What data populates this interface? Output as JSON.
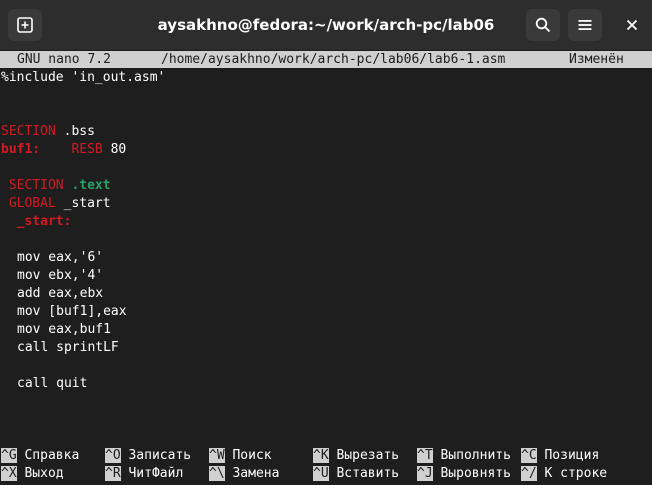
{
  "window": {
    "title": "aysakhno@fedora:~/work/arch-pc/lab06",
    "icons": [
      "new-tab-icon",
      "search-icon",
      "hamburger-menu-icon",
      "close-icon"
    ]
  },
  "nano": {
    "version": "GNU nano 7.2",
    "path": "/home/aysakhno/work/arch-pc/lab06/lab6-1.asm",
    "status": "Изменён"
  },
  "code": {
    "include": "%include 'in_out.asm'",
    "section_bss_kw": "SECTION",
    "section_bss_name": " .bss",
    "buf_label": "buf1:",
    "buf_resb": "RESB",
    "buf_size": " 80",
    "section_text_kw": "SECTION",
    "section_text_name": " .text",
    "global_kw": "GLOBAL",
    "global_name": " _start",
    "start_label": "_start:",
    "l1": "mov eax,'6'",
    "l2": "mov ebx,'4'",
    "l3": "add eax,ebx",
    "l4": "mov [buf1],eax",
    "l5": "mov eax,buf1",
    "l6": "call sprintLF",
    "l7": "call quit"
  },
  "shortcuts": [
    {
      "key": "^G",
      "label": "Справка"
    },
    {
      "key": "^O",
      "label": "Записать"
    },
    {
      "key": "^W",
      "label": "Поиск"
    },
    {
      "key": "^K",
      "label": "Вырезать"
    },
    {
      "key": "^T",
      "label": "Выполнить"
    },
    {
      "key": "^C",
      "label": "Позиция"
    },
    {
      "key": "^X",
      "label": "Выход"
    },
    {
      "key": "^R",
      "label": "ЧитФайл"
    },
    {
      "key": "^\\",
      "label": "Замена"
    },
    {
      "key": "^U",
      "label": "Вставить"
    },
    {
      "key": "^J",
      "label": "Выровнять"
    },
    {
      "key": "^/",
      "label": "К строке"
    }
  ]
}
